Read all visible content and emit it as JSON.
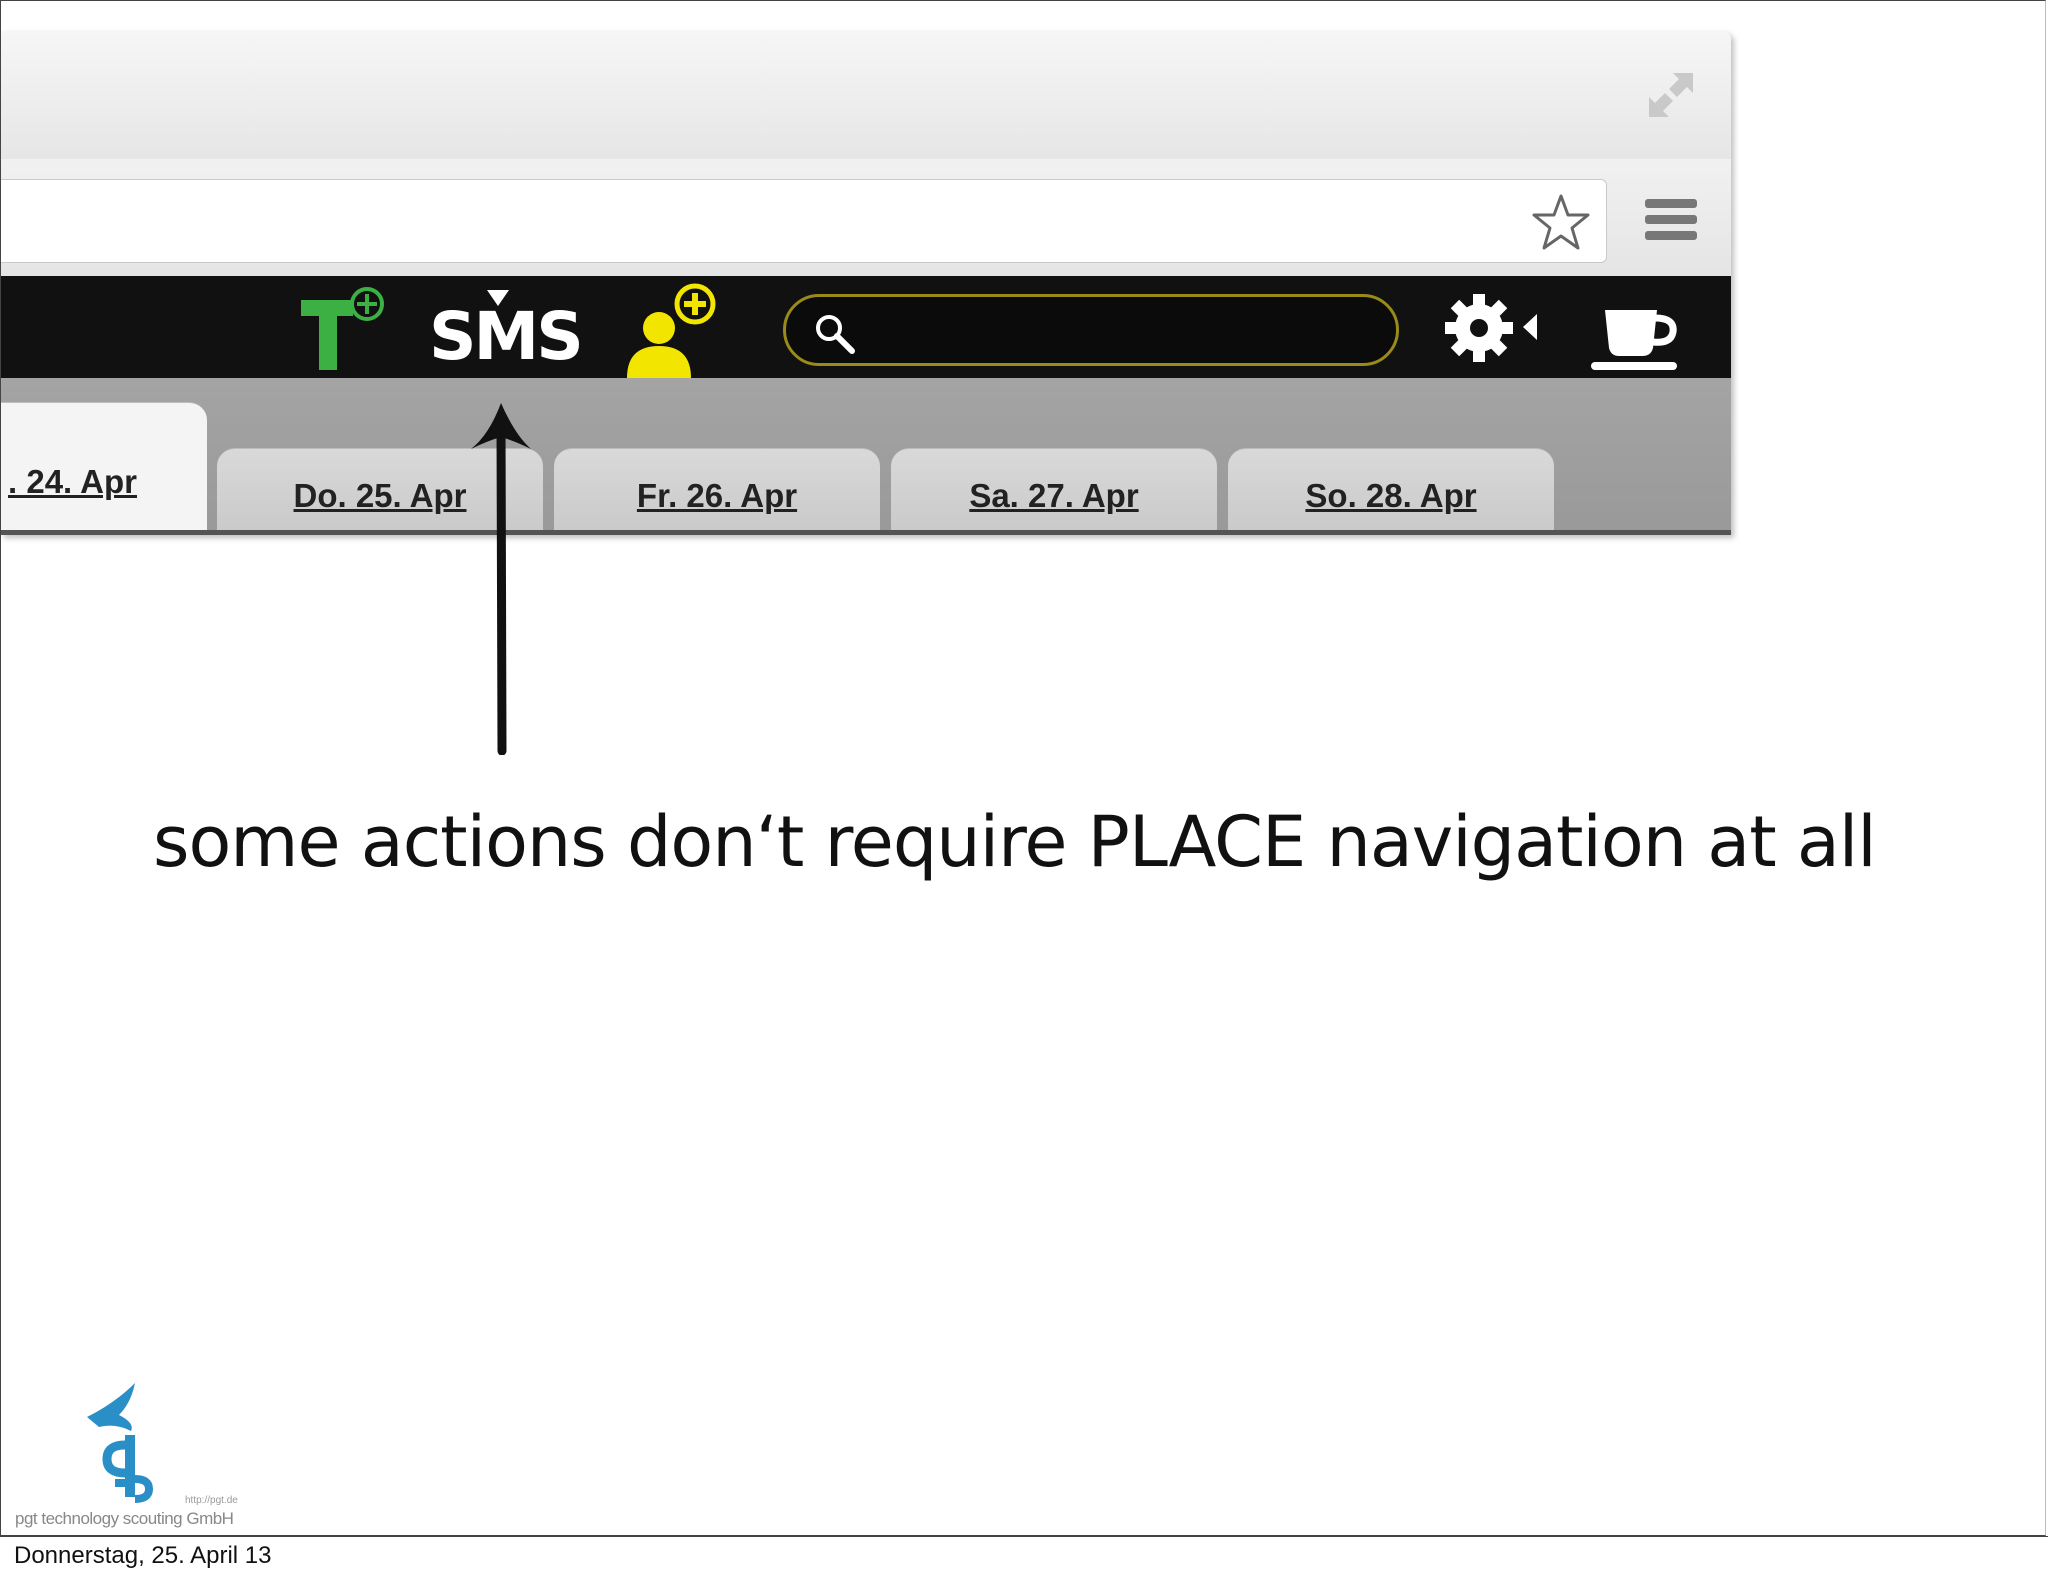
{
  "browser": {
    "address_value": "",
    "search": {
      "value": "",
      "placeholder": ""
    },
    "app_icons": {
      "sms_label": "SMS"
    },
    "tabs": [
      {
        "label": ". 24. Apr",
        "active": true
      },
      {
        "label": "Do. 25. Apr",
        "active": false
      },
      {
        "label": "Fr. 26. Apr",
        "active": false
      },
      {
        "label": "Sa. 27. Apr",
        "active": false
      },
      {
        "label": "So. 28. Apr",
        "active": false
      }
    ]
  },
  "slide": {
    "caption": "some actions don‘t require PLACE navigation at all"
  },
  "logo": {
    "text": "pgt technology scouting GmbH",
    "url": "http://pgt.de"
  },
  "footer": {
    "date": "Donnerstag, 25. April 13"
  },
  "colors": {
    "t_icon_green": "#3cb043",
    "user_icon_yellow": "#f2e600",
    "app_bar": "#111111",
    "search_border": "#9a8a1a",
    "logo_blue": "#2a8fc6"
  }
}
